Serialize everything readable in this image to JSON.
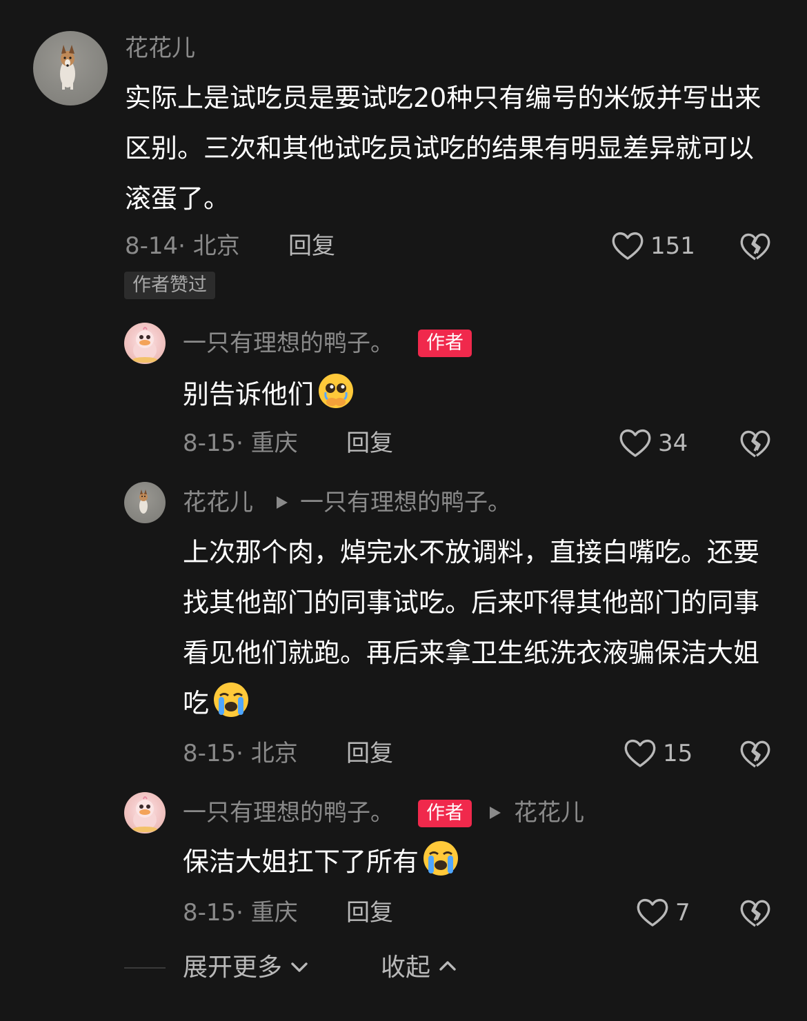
{
  "comments": [
    {
      "author": "花花儿",
      "text": "实际上是试吃员是要试吃20种只有编号的米饭并写出来区别。三次和其他试吃员试吃的结果有明显差异就可以滚蛋了。",
      "date_location": "8-14· 北京",
      "reply_label": "回复",
      "likes": "151",
      "badge": "作者赞过",
      "avatar_icon": "dog-avatar"
    }
  ],
  "replies": [
    {
      "author": "一只有理想的鸭子。",
      "author_badge": "作者",
      "text": "别告诉他们",
      "emoji": "pleading-crying-emoji",
      "date_location": "8-15· 重庆",
      "reply_label": "回复",
      "likes": "34",
      "avatar_icon": "duck-avatar"
    },
    {
      "author": "花花儿",
      "reply_to": "一只有理想的鸭子。",
      "text": "上次那个肉，焯完水不放调料，直接白嘴吃。还要找其他部门的同事试吃。后来吓得其他部门的同事看见他们就跑。再后来拿卫生纸洗衣液骗保洁大姐吃",
      "emoji": "loudly-crying-emoji",
      "date_location": "8-15· 北京",
      "reply_label": "回复",
      "likes": "15",
      "avatar_icon": "dog-avatar"
    },
    {
      "author": "一只有理想的鸭子。",
      "author_badge": "作者",
      "reply_to": "花花儿",
      "text": "保洁大姐扛下了所有",
      "emoji": "loudly-crying-emoji",
      "date_location": "8-15· 重庆",
      "reply_label": "回复",
      "likes": "7",
      "avatar_icon": "duck-avatar"
    }
  ],
  "footer": {
    "expand_label": "展开更多",
    "collapse_label": "收起"
  },
  "colors": {
    "background": "#161616",
    "author_badge": "#f0294c",
    "muted_text": "#8a8a8a",
    "body_text": "#ffffff"
  }
}
